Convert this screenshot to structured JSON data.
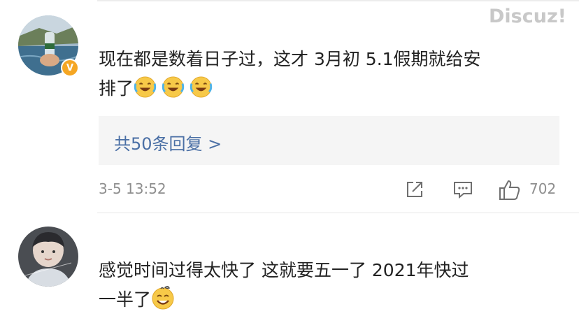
{
  "watermark": "Discuz!",
  "comments": [
    {
      "text": "现在都是数着日子过，这才 3月初 5.1假期就给安\n排了",
      "emoji_count": 3,
      "emoji": "laugh-cry-emoji",
      "verified_badge": "V",
      "replies_label": "共50条回复 >",
      "time": "3-5 13:52",
      "likes": "702"
    },
    {
      "text": "感觉时间过得太快了 这就要五一了 2021年快过\n一半了",
      "emoji": "sweat-smile-emoji"
    }
  ],
  "colors": {
    "link": "#4a6fa5",
    "meta": "#8e8e8e",
    "reply_bg": "#f5f5f5",
    "badge": "#f5a623"
  }
}
